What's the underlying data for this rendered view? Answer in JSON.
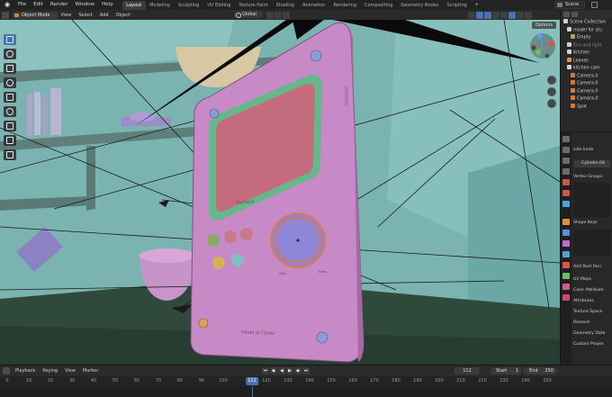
{
  "menubar": {
    "items": [
      "File",
      "Edit",
      "Render",
      "Window",
      "Help"
    ],
    "workspaces": [
      "Layout",
      "Modeling",
      "Sculpting",
      "UV Editing",
      "Texture Paint",
      "Shading",
      "Animation",
      "Rendering",
      "Compositing",
      "Geometry Nodes",
      "Scripting"
    ],
    "active_workspace": "Layout",
    "plus": "+",
    "scene": "Scene"
  },
  "viewport_header": {
    "mode": "Object Mode",
    "menus": [
      "View",
      "Select",
      "Add",
      "Object"
    ],
    "orientation": "Global",
    "options": "Options"
  },
  "scene_text": {
    "brand": "Sunwyn",
    "made_in": "Made in China",
    "min_label": "Min",
    "max_label": "Max"
  },
  "outliner": {
    "rows": [
      {
        "label": "Scene Collection",
        "icon": "collection-icon",
        "color": "#d0d0d0",
        "indent": 0,
        "dim": false
      },
      {
        "label": "model for stu",
        "icon": "collection-icon",
        "color": "#d0d0d0",
        "indent": 1,
        "dim": false
      },
      {
        "label": "Empty",
        "icon": "empty-icon",
        "color": "#c0a060",
        "indent": 2,
        "dim": false
      },
      {
        "label": "Env and light",
        "icon": "collection-icon",
        "color": "#d0d0d0",
        "indent": 1,
        "dim": true
      },
      {
        "label": "Kitchen",
        "icon": "collection-icon",
        "color": "#d0d0d0",
        "indent": 1,
        "dim": false
      },
      {
        "label": "Leaves",
        "icon": "mesh-icon",
        "color": "#e09040",
        "indent": 1,
        "dim": false
      },
      {
        "label": "kitchen cam",
        "icon": "collection-icon",
        "color": "#d0d0d0",
        "indent": 1,
        "dim": false
      },
      {
        "label": "Camera.0",
        "icon": "camera-icon",
        "color": "#d67a3a",
        "indent": 2,
        "dim": false
      },
      {
        "label": "Camera.0",
        "icon": "camera-icon",
        "color": "#d67a3a",
        "indent": 2,
        "dim": false
      },
      {
        "label": "Camera.0",
        "icon": "camera-icon",
        "color": "#d67a3a",
        "indent": 2,
        "dim": false
      },
      {
        "label": "Camera.0",
        "icon": "camera-icon",
        "color": "#d67a3a",
        "indent": 2,
        "dim": false
      },
      {
        "label": "Spot",
        "icon": "light-icon",
        "color": "#d67a3a",
        "indent": 2,
        "dim": false
      }
    ]
  },
  "properties": {
    "object_name": "side knob",
    "mesh_name": "Cylinder.00",
    "panels": {
      "vertex_groups": "Vertex Groups",
      "shape_keys": "Shape Keys",
      "add_rest": "Add Rest Posi",
      "uv_maps": "UV Maps",
      "color_attributes": "Color Attribute",
      "attributes": "Attributes",
      "texture_space": "Texture Space",
      "remesh": "Remesh",
      "geometry_data": "Geometry Data",
      "custom_properties": "Custom Proper"
    }
  },
  "timeline": {
    "menus": [
      "Playback",
      "Keying",
      "View",
      "Marker"
    ],
    "current_frame": "112",
    "start_label": "Start",
    "start_value": "1",
    "end_label": "End",
    "end_value": "250",
    "ticks": [
      "0",
      "10",
      "20",
      "30",
      "40",
      "50",
      "60",
      "70",
      "80",
      "90",
      "100",
      "120",
      "130",
      "140",
      "150",
      "160",
      "170",
      "180",
      "190",
      "200",
      "210",
      "220",
      "230",
      "240",
      "250"
    ],
    "ruler_frame": "112"
  },
  "colors": {
    "accent": "#4772b3",
    "device_body": "#c87fc4",
    "screen": "#c86e80",
    "screen_frame": "#6fb88a",
    "walls": "#7fb7b4",
    "selection_outline": "#e87a30"
  }
}
